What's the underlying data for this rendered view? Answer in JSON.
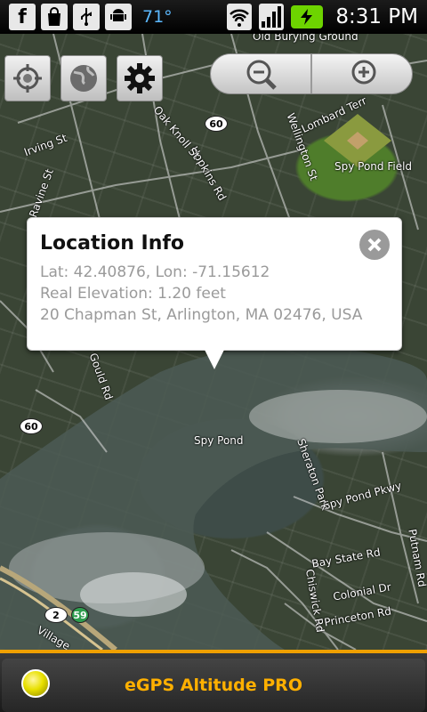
{
  "status_bar": {
    "temperature": "71°",
    "time": "8:31 PM",
    "notification_icons": [
      "facebook-icon",
      "bag-icon",
      "usb-icon",
      "android-icon"
    ],
    "system_icons": [
      "wifi-icon",
      "signal-icon",
      "battery-icon"
    ]
  },
  "map_controls": {
    "buttons": [
      "location-icon",
      "globe-icon",
      "gear-icon"
    ],
    "zoom": [
      "zoom-out-icon",
      "zoom-in-icon"
    ]
  },
  "map": {
    "labels": [
      "Old Burying Ground",
      "Spy Pond Field",
      "Spy Pond",
      "Irving St",
      "Ravine St",
      "Hopkins Rd",
      "Wellington St",
      "Oak Knoll St",
      "Lombard Terr",
      "Gould Rd",
      "Spy Pond Pkwy",
      "Bay State Rd",
      "Colonial Dr",
      "Princeton Rd",
      "Putnam Rd",
      "Chiswick Rd",
      "Sheraton Park",
      "Village"
    ],
    "route_shields": [
      "60",
      "60",
      "2",
      "59"
    ]
  },
  "popup": {
    "title": "Location Info",
    "lat_lon": "Lat: 42.40876, Lon: -71.15612",
    "elevation": "Real Elevation: 1.20 feet",
    "address": "20 Chapman St, Arlington, MA 02476, USA"
  },
  "bottom_bar": {
    "title": "eGPS Altitude PRO"
  }
}
